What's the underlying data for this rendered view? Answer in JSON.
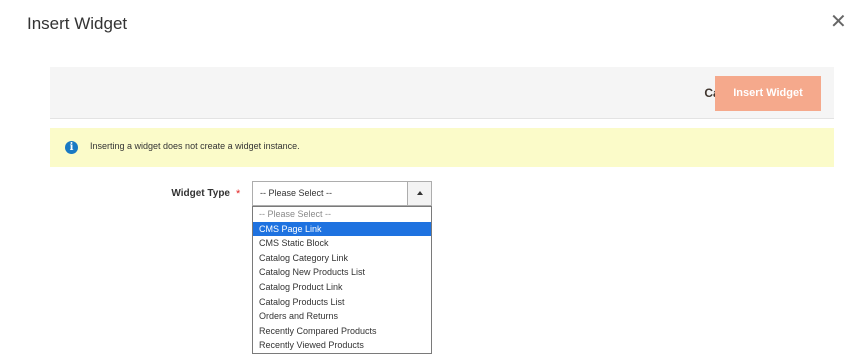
{
  "modal": {
    "title": "Insert Widget"
  },
  "actions": {
    "cancel_label": "Cancel",
    "insert_label": "Insert Widget"
  },
  "message": {
    "text": "Inserting a widget does not create a widget instance."
  },
  "form": {
    "widget_type": {
      "label": "Widget Type",
      "required_mark": "*",
      "selected_value": "-- Please Select --",
      "options": [
        "-- Please Select --",
        "CMS Page Link",
        "CMS Static Block",
        "Catalog Category Link",
        "Catalog New Products List",
        "Catalog Product Link",
        "Catalog Products List",
        "Orders and Returns",
        "Recently Compared Products",
        "Recently Viewed Products"
      ],
      "highlighted_option": "CMS Page Link"
    }
  },
  "colors": {
    "primary_button": "#f5a98c",
    "message_background": "#fbfbc9",
    "info_icon": "#1979c3",
    "option_highlight": "#1e72e0",
    "required_star": "#e22626"
  },
  "icons": {
    "close": "close-icon",
    "info": "info-icon",
    "select_arrow": "chevron-up-icon"
  }
}
